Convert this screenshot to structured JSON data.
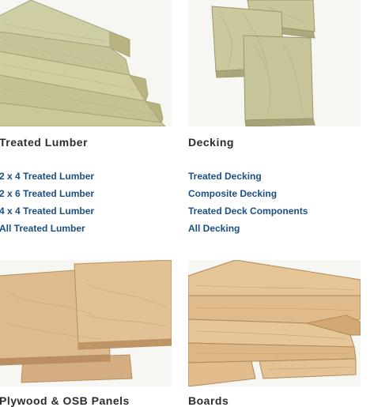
{
  "categories": [
    {
      "title": "Treated Lumber",
      "image": "treated-lumber-stack-photo",
      "links": [
        "2 x 4 Treated Lumber",
        "2 x 6 Treated Lumber",
        "4 x 4 Treated Lumber",
        "All Treated Lumber"
      ]
    },
    {
      "title": "Decking",
      "image": "decking-boards-photo",
      "links": [
        "Treated Decking",
        "Composite Decking",
        "Treated Deck Components",
        "All Decking"
      ]
    },
    {
      "title": "Plywood & OSB Panels",
      "image": "plywood-panels-photo",
      "links": []
    },
    {
      "title": "Boards",
      "image": "boards-stack-photo",
      "links": []
    }
  ],
  "colors": {
    "link": "#1b4f86",
    "title": "#2d2d2d",
    "treated_wood": "#c9c79a",
    "plywood": "#dcb98f",
    "boards": "#e2bf8f"
  }
}
